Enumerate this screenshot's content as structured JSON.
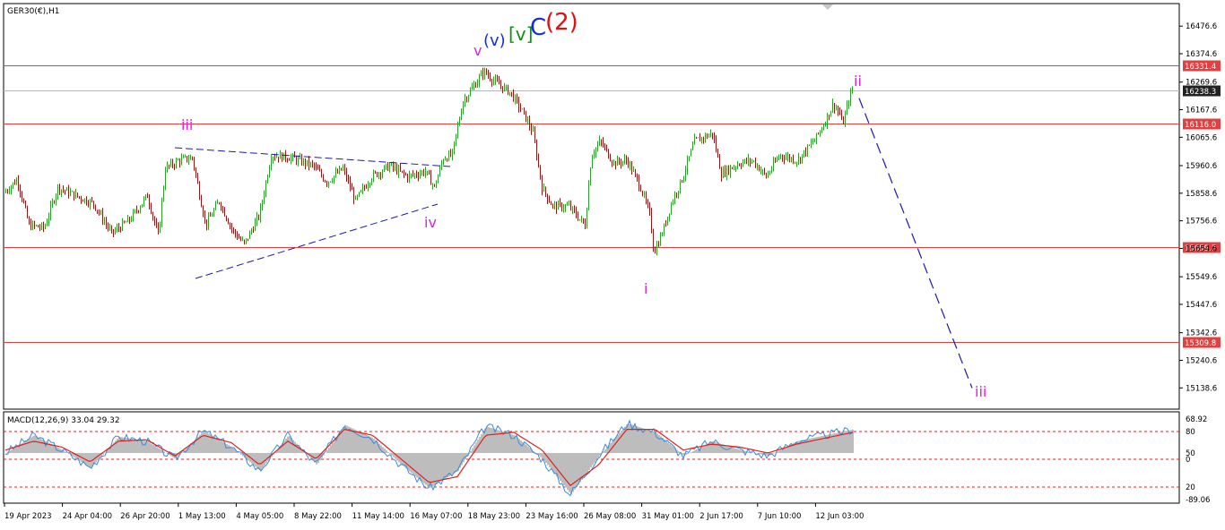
{
  "symbol_label": "GER30(€),H1",
  "macd_label": "MACD(12,26,9) 33.04 29.32",
  "colors": {
    "bull": "#2e9e2e",
    "bear": "#8b1a1a",
    "hline": "#e04040",
    "price_marker": "#222222",
    "wave_magenta": "#e020e0",
    "wave_blue": "#1030e0",
    "wave_green": "#109010",
    "wave_red": "#e01010",
    "projection": "#1a1ab0",
    "macd_hist": "#bdbdbd",
    "macd_main": "#3a8bd8",
    "macd_signal": "#e02020"
  },
  "chart_data": [
    {
      "type": "candlestick",
      "title": "GER30(€),H1",
      "ylim": [
        15060,
        16560
      ],
      "y_ticks": [
        "16476.6",
        "16374.6",
        "16269.6",
        "16167.6",
        "16065.6",
        "15960.6",
        "15858.6",
        "15756.6",
        "15654.6",
        "15549.6",
        "15447.6",
        "15342.6",
        "15240.6",
        "15138.6"
      ],
      "x_ticks": [
        "19 Apr 2023",
        "24 Apr 04:00",
        "26 Apr 20:00",
        "1 May 13:00",
        "4 May 05:00",
        "8 May 22:00",
        "11 May 14:00",
        "16 May 07:00",
        "18 May 23:00",
        "23 May 16:00",
        "26 May 08:00",
        "31 May 01:00",
        "2 Jun 17:00",
        "7 Jun 10:00",
        "12 Jun 03:00"
      ],
      "horizontal_lines": [
        {
          "value": 16331.4,
          "label": "16331.4"
        },
        {
          "value": 16116.0,
          "label": "16116.0"
        },
        {
          "value": 15659.7,
          "label": "15659.7"
        },
        {
          "value": 15309.8,
          "label": "15309.8"
        }
      ],
      "current_price": {
        "value": 16238.3,
        "label": "16238.3"
      },
      "price_path": [
        [
          0,
          15860
        ],
        [
          15,
          15910
        ],
        [
          28,
          15740
        ],
        [
          45,
          15730
        ],
        [
          60,
          15880
        ],
        [
          80,
          15850
        ],
        [
          100,
          15820
        ],
        [
          120,
          15710
        ],
        [
          140,
          15760
        ],
        [
          160,
          15850
        ],
        [
          172,
          15700
        ],
        [
          180,
          15950
        ],
        [
          195,
          15980
        ],
        [
          210,
          15990
        ],
        [
          225,
          15740
        ],
        [
          240,
          15830
        ],
        [
          255,
          15720
        ],
        [
          268,
          15670
        ],
        [
          285,
          15780
        ],
        [
          298,
          16000
        ],
        [
          320,
          15990
        ],
        [
          345,
          15960
        ],
        [
          360,
          15900
        ],
        [
          378,
          15950
        ],
        [
          392,
          15830
        ],
        [
          410,
          15920
        ],
        [
          430,
          15960
        ],
        [
          450,
          15920
        ],
        [
          470,
          15940
        ],
        [
          480,
          15880
        ],
        [
          490,
          15990
        ],
        [
          500,
          16000
        ],
        [
          505,
          16090
        ],
        [
          512,
          16200
        ],
        [
          525,
          16260
        ],
        [
          535,
          16310
        ],
        [
          548,
          16270
        ],
        [
          565,
          16230
        ],
        [
          580,
          16150
        ],
        [
          590,
          16080
        ],
        [
          600,
          15880
        ],
        [
          612,
          15810
        ],
        [
          630,
          15810
        ],
        [
          648,
          15740
        ],
        [
          655,
          16000
        ],
        [
          665,
          16050
        ],
        [
          680,
          15970
        ],
        [
          695,
          15980
        ],
        [
          710,
          15880
        ],
        [
          720,
          15780
        ],
        [
          725,
          15640
        ],
        [
          735,
          15720
        ],
        [
          745,
          15830
        ],
        [
          755,
          15900
        ],
        [
          770,
          16050
        ],
        [
          790,
          16080
        ],
        [
          800,
          15930
        ],
        [
          820,
          15970
        ],
        [
          835,
          15980
        ],
        [
          850,
          15920
        ],
        [
          865,
          16000
        ],
        [
          885,
          15980
        ],
        [
          905,
          16060
        ],
        [
          915,
          16120
        ],
        [
          925,
          16190
        ],
        [
          932,
          16150
        ],
        [
          935,
          16110
        ],
        [
          945,
          16240
        ]
      ],
      "wave_labels": [
        {
          "text": "iii",
          "color": "magenta"
        },
        {
          "text": "iv",
          "color": "magenta"
        },
        {
          "text": "v",
          "color": "magenta"
        },
        {
          "text": "(v)",
          "color": "blue"
        },
        {
          "text": "[v]",
          "color": "green"
        },
        {
          "text": "C",
          "color": "blue"
        },
        {
          "text": "(2)",
          "color": "red"
        },
        {
          "text": "i",
          "color": "magenta"
        },
        {
          "text": "ii",
          "color": "magenta"
        },
        {
          "text": "iii",
          "color": "magenta"
        }
      ],
      "projection": {
        "from_price": 16210,
        "to_price": 15138
      }
    },
    {
      "type": "line",
      "title": "MACD(12,26,9) 33.04 29.32",
      "ylim": [
        5,
        75
      ],
      "y_ticks": [
        "68.92",
        "80",
        "50",
        "0",
        "20",
        "-89.06"
      ],
      "levels": [
        68.92,
        43.8,
        19.7
      ],
      "series": [
        {
          "values": [
            0,
            60,
            10,
            -50,
            55,
            40,
            -20,
            75,
            20,
            -60,
            60,
            -40,
            95,
            50,
            -40,
            -120,
            -60,
            90,
            60,
            -20,
            -140,
            -10,
            100,
            70,
            -10,
            40,
            10,
            -10,
            40,
            60,
            80
          ]
        },
        {
          "values": [
            10,
            40,
            20,
            -30,
            40,
            45,
            -10,
            60,
            35,
            -40,
            40,
            -20,
            80,
            60,
            -20,
            -100,
            -80,
            60,
            70,
            10,
            -110,
            -40,
            80,
            80,
            10,
            30,
            20,
            0,
            30,
            50,
            70
          ]
        }
      ]
    }
  ]
}
